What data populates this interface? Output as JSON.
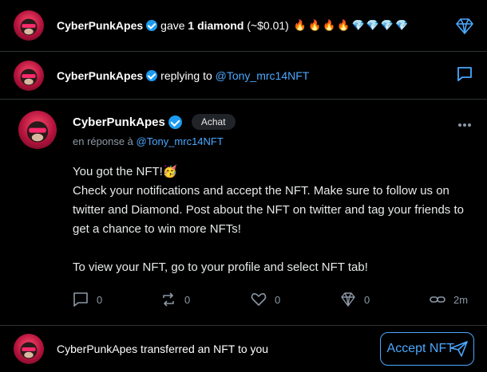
{
  "notif1": {
    "user": "CyberPunkApes",
    "text_before": "gave",
    "amount": "1 diamond",
    "value": "(~$0.01)",
    "emojis": [
      "🔥",
      "🔥",
      "🔥",
      "🔥",
      "💎",
      "💎",
      "💎",
      "💎"
    ]
  },
  "notif2": {
    "user": "CyberPunkApes",
    "replying_label": "replying to",
    "mention": "@Tony_mrc14NFT"
  },
  "post": {
    "user": "CyberPunkApes",
    "badge": "Achat",
    "reply_prefix": "en réponse à",
    "reply_mention": "@Tony_mrc14NFT",
    "line1": "You got the NFT!🥳",
    "line2": "Check your notifications and accept the NFT. Make sure to follow us on twitter and Diamond. Post about the NFT on twitter and tag your friends to get a chance to win more NFTs!",
    "line3": "To view your NFT, go to your profile and select NFT tab!",
    "actions": {
      "comments": "0",
      "reposts": "0",
      "likes": "0",
      "diamonds": "0",
      "time": "2m"
    }
  },
  "notif3": {
    "text": "CyberPunkApes transferred an NFT to you",
    "button": "Accept NFT"
  },
  "colors": {
    "accent": "#4aa8ff",
    "verified": "#1d9bf0",
    "divider": "#2f3336"
  }
}
